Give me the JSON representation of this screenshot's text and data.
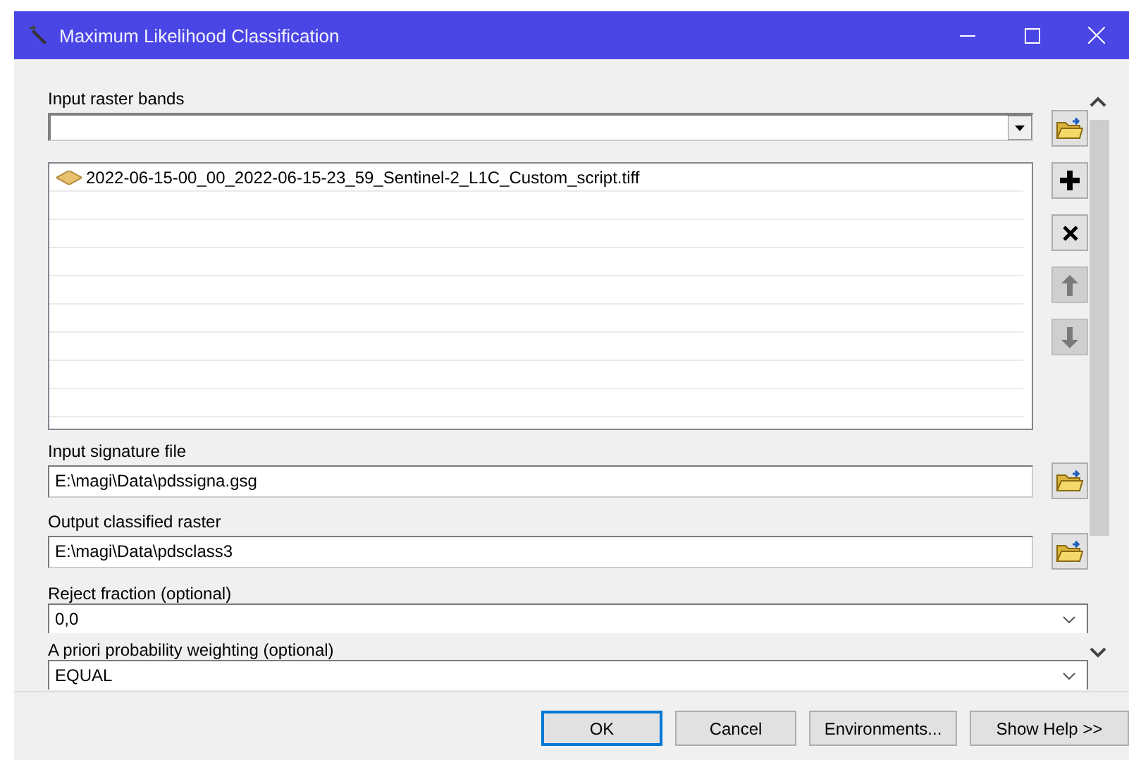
{
  "window": {
    "title": "Maximum Likelihood Classification"
  },
  "parameters": [
    {
      "kind": "list",
      "label": "Input raster bands",
      "items": [
        "2022-06-15-00_00_2022-06-15-23_59_Sentinel-2_L1C_Custom_script.tiff"
      ]
    },
    {
      "kind": "file",
      "label": "Input signature file",
      "value": "E:\\magi\\Data\\pdssigna.gsg"
    },
    {
      "kind": "file",
      "label": "Output classified raster",
      "value": "E:\\magi\\Data\\pdsclass3"
    },
    {
      "kind": "dropdown",
      "label": "Reject fraction (optional)",
      "value": "0,0"
    },
    {
      "kind": "dropdown",
      "label": "A priori probability weighting (optional)",
      "value": "EQUAL"
    }
  ],
  "list_buttons": [
    {
      "kind": "add",
      "disabled": false
    },
    {
      "kind": "remove",
      "disabled": false
    },
    {
      "kind": "up",
      "disabled": true
    },
    {
      "kind": "down",
      "disabled": true
    }
  ],
  "buttons": [
    {
      "label": "OK",
      "focused": true
    },
    {
      "label": "Cancel",
      "focused": false
    },
    {
      "label": "Environments...",
      "focused": false
    },
    {
      "label": "Show Help >>",
      "focused": false
    }
  ]
}
